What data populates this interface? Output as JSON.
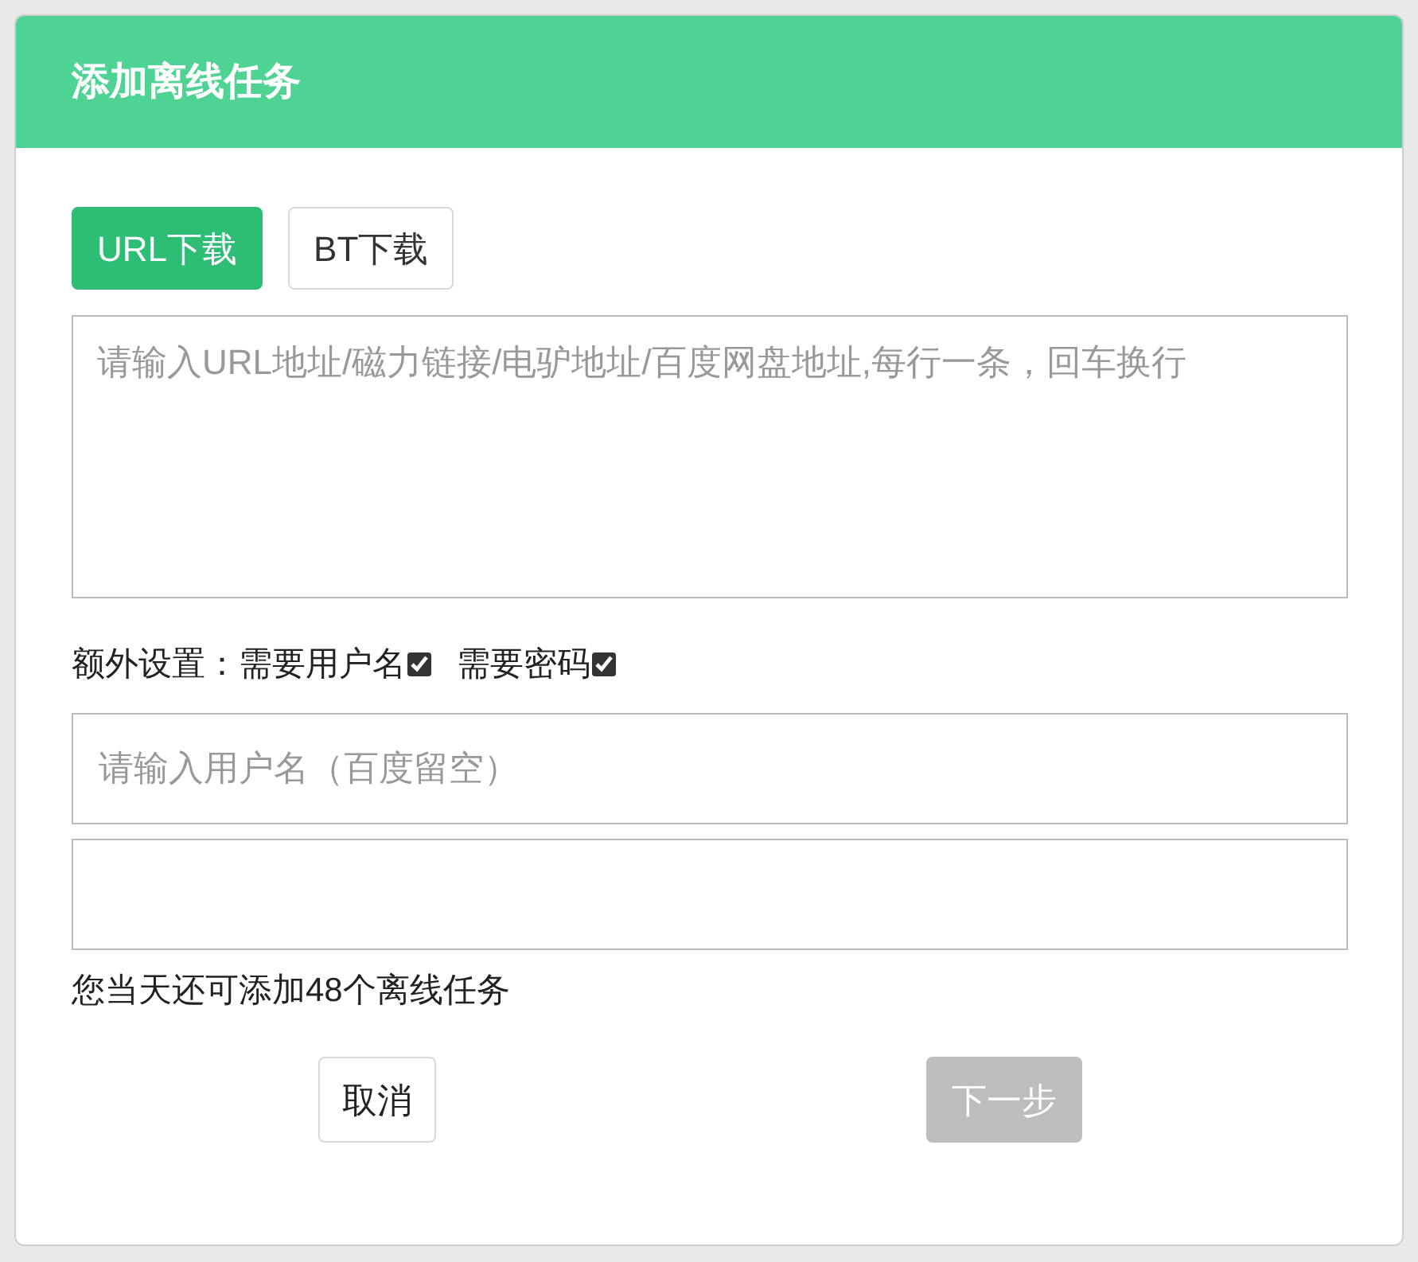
{
  "dialog": {
    "title": "添加离线任务"
  },
  "tabs": [
    {
      "label": "URL下载",
      "selected": true
    },
    {
      "label": "BT下载",
      "selected": false
    }
  ],
  "links_field": {
    "placeholder": "请输入URL地址/磁力链接/电驴地址/百度网盘地址,每行一条，回车换行"
  },
  "extra_settings": {
    "label": "额外设置：",
    "options": [
      {
        "label": "需要用户名",
        "checked": true
      },
      {
        "label": "需要密码",
        "checked": true
      }
    ]
  },
  "username_field": {
    "placeholder": "请输入用户名（百度留空）"
  },
  "quota_note": "您当天还可添加48个离线任务",
  "buttons": [
    {
      "label": "取消",
      "disabled": false
    },
    {
      "label": "下一步",
      "disabled": true
    }
  ]
}
